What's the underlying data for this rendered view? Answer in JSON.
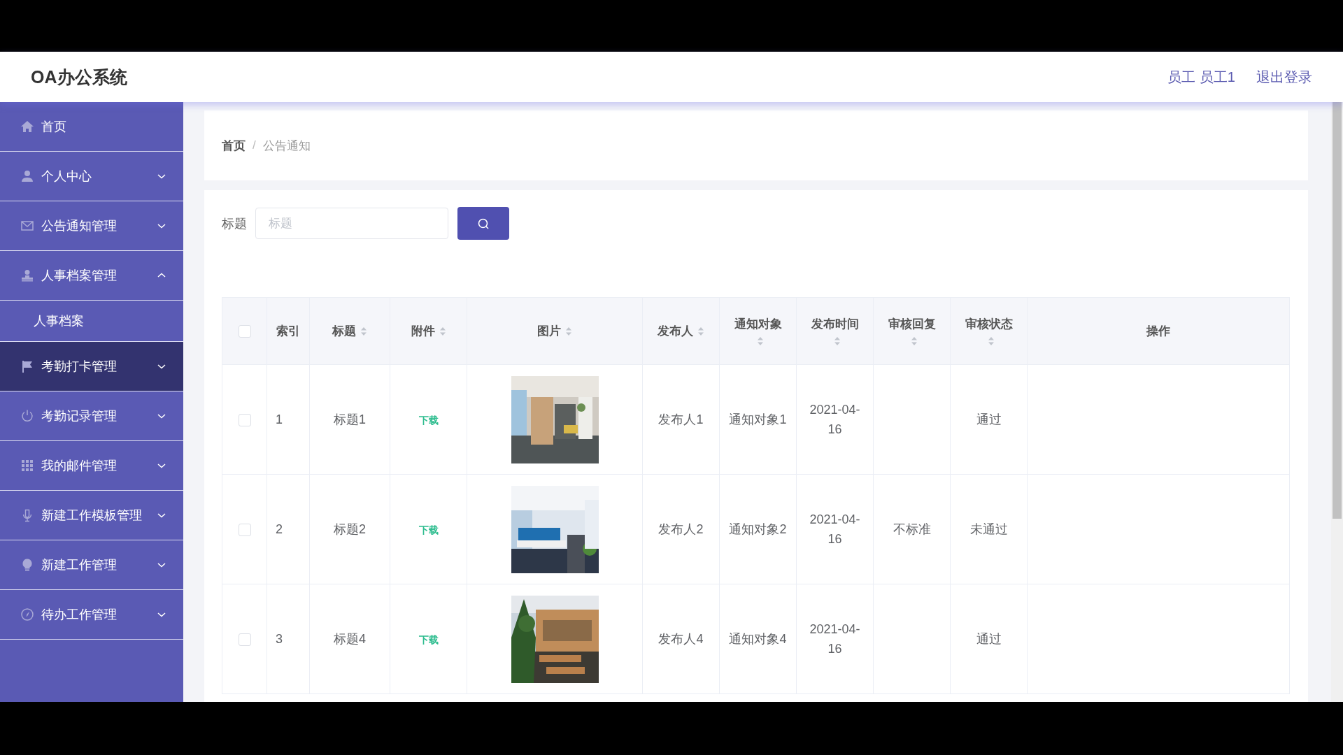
{
  "header": {
    "title": "OA办公系统",
    "user": "员工 员工1",
    "logout": "退出登录"
  },
  "sidebar": {
    "items": [
      {
        "label": "首页",
        "selected": false
      },
      {
        "label": "个人中心",
        "expanded": false,
        "selected": false
      },
      {
        "label": "公告通知管理",
        "expanded": false,
        "selected": false
      },
      {
        "label": "人事档案管理",
        "expanded": true,
        "selected": false,
        "children": [
          {
            "label": "人事档案",
            "selected": false
          }
        ]
      },
      {
        "label": "考勤打卡管理",
        "expanded": false,
        "selected": true
      },
      {
        "label": "考勤记录管理",
        "expanded": false,
        "selected": false
      },
      {
        "label": "我的邮件管理",
        "expanded": false,
        "selected": false
      },
      {
        "label": "新建工作模板管理",
        "expanded": false,
        "selected": false
      },
      {
        "label": "新建工作管理",
        "expanded": false,
        "selected": false
      },
      {
        "label": "待办工作管理",
        "expanded": false,
        "selected": false
      }
    ]
  },
  "breadcrumb": {
    "items": [
      "首页",
      "公告通知"
    ],
    "separator": "/"
  },
  "search": {
    "label": "标题",
    "placeholder": "标题"
  },
  "table": {
    "columns": [
      {
        "label": "索引",
        "sortable": false
      },
      {
        "label": "标题",
        "sortable": true
      },
      {
        "label": "附件",
        "sortable": true
      },
      {
        "label": "图片",
        "sortable": true
      },
      {
        "label": "发布人",
        "sortable": true
      },
      {
        "label": "通知对象",
        "sortable": true
      },
      {
        "label": "发布时间",
        "sortable": true
      },
      {
        "label": "审核回复",
        "sortable": true
      },
      {
        "label": "审核状态",
        "sortable": true
      },
      {
        "label": "操作",
        "sortable": false
      }
    ],
    "all_checked": false,
    "rows": [
      {
        "checked": false,
        "index": "1",
        "title": "标题1",
        "attachment": "下载",
        "publisher": "发布人1",
        "target": "通知对象1",
        "time": "2021-04-16",
        "status": "通过"
      },
      {
        "checked": false,
        "index": "2",
        "title": "标题2",
        "attachment": "下载",
        "publisher": "发布人2",
        "target": "通知对象2",
        "time": "2021-04-16",
        "reply": "不标准",
        "status": "未通过"
      },
      {
        "checked": false,
        "index": "3",
        "title": "标题4",
        "attachment": "下载",
        "publisher": "发布人4",
        "target": "通知对象4",
        "time": "2021-04-16",
        "status": "通过"
      }
    ]
  }
}
